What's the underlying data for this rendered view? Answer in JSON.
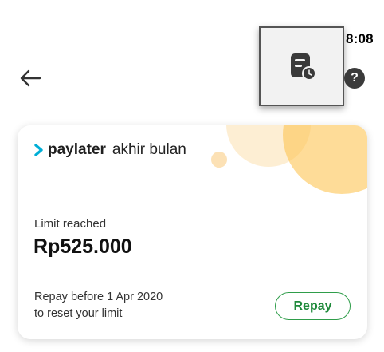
{
  "status_bar": {
    "time": "8:08"
  },
  "header": {
    "back_icon": "arrow-left-icon",
    "history_icon": "bill-history-icon",
    "help_label": "?"
  },
  "card": {
    "brand": {
      "name": "paylater",
      "suffix": "akhir bulan",
      "logo_icon": "chevron-logo-icon",
      "accent_color": "#00aed6"
    },
    "limit_label": "Limit reached",
    "limit_amount": "Rp525.000",
    "repay_note_line1": "Repay before 1 Apr 2020",
    "repay_note_line2": "to reset your limit",
    "repay_button": "Repay",
    "button_color": "#1f8a3b"
  }
}
